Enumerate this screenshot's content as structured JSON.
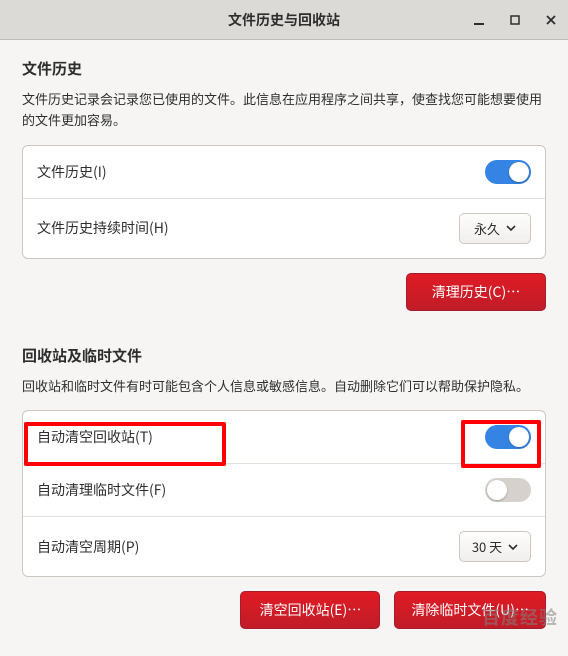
{
  "window": {
    "title": "文件历史与回收站"
  },
  "history": {
    "section_title": "文件历史",
    "section_desc": "文件历史记录会记录您已使用的文件。此信息在应用程序之间共享，使查找您可能想要使用的文件更加容易。",
    "row_history_label": "文件历史(I)",
    "row_history_on": true,
    "row_duration_label": "文件历史持续时间(H)",
    "row_duration_value": "永久",
    "clear_history_btn": "清理历史(C)…"
  },
  "trash": {
    "section_title": "回收站及临时文件",
    "section_desc": "回收站和临时文件有时可能包含个人信息或敏感信息。自动删除它们可以帮助保护隐私。",
    "row_auto_trash_label": "自动清空回收站(T)",
    "row_auto_trash_on": true,
    "row_auto_temp_label": "自动清理临时文件(F)",
    "row_auto_temp_on": false,
    "row_period_label": "自动清空周期(P)",
    "row_period_value": "30 天",
    "empty_trash_btn": "清空回收站(E)…",
    "clear_temp_btn": "清除临时文件(U)…"
  },
  "watermark": "百度经验"
}
